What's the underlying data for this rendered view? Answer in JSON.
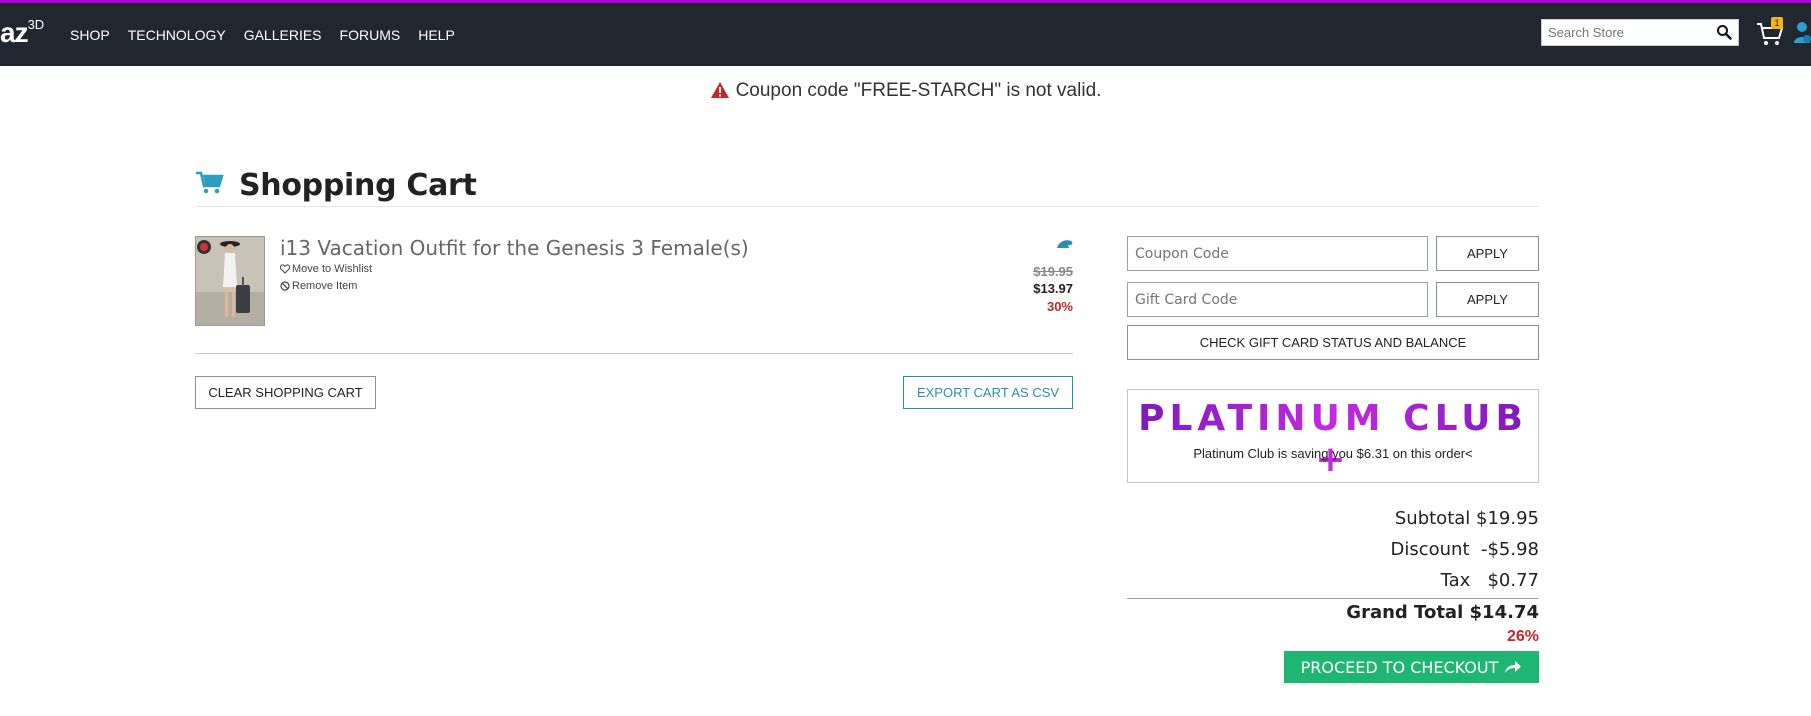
{
  "colors": {
    "accent_bar": "#b000d8",
    "nav_bg": "#202730",
    "teal": "#2a8fa8",
    "checkout_green": "#1fb573",
    "sale_red": "#c2282e"
  },
  "header": {
    "logo_text": "az",
    "logo_sup": "3D",
    "nav": [
      "SHOP",
      "TECHNOLOGY",
      "GALLERIES",
      "FORUMS",
      "HELP"
    ],
    "search_placeholder": "Search Store",
    "cart_count": "1"
  },
  "alert": {
    "message": "Coupon code \"FREE-STARCH\" is not valid."
  },
  "cart": {
    "title": "Shopping Cart",
    "item": {
      "name": "i13 Vacation Outfit for the Genesis 3 Female(s)",
      "wishlist_label": "Move to Wishlist",
      "remove_label": "Remove Item",
      "original_price": "$19.95",
      "price": "$13.97",
      "discount_pct": "30%"
    },
    "clear_label": "CLEAR SHOPPING CART",
    "export_label": "EXPORT CART AS CSV"
  },
  "sidebar": {
    "coupon_placeholder": "Coupon Code",
    "gift_placeholder": "Gift Card Code",
    "apply_label": "APPLY",
    "gift_status_label": "CHECK GIFT CARD STATUS AND BALANCE",
    "platinum_logo": "PLATINUM CLUB +",
    "platinum_text": "Platinum Club is saving you $6.31 on this order<"
  },
  "summary": {
    "subtotal_label": "Subtotal",
    "subtotal": "$19.95",
    "discount_label": "Discount",
    "discount": "-$5.98",
    "tax_label": "Tax",
    "tax": "$0.77",
    "grand_total_label": "Grand Total",
    "grand_total": "$14.74",
    "savings_pct": "26%",
    "checkout_label": "PROCEED TO CHECKOUT"
  }
}
